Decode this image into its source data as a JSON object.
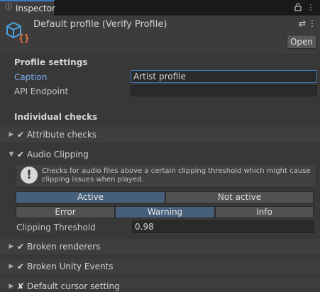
{
  "window": {
    "tab_label": "Inspector",
    "tab_icon": "info-icon",
    "lock_icon": "lock-icon",
    "menu_icon": "more-vertical-icon"
  },
  "header": {
    "title": "Default profile (Verify Profile)",
    "asset_icon": "cube-asset-icon",
    "settings_icon": "sliders-icon",
    "menu_icon": "more-vertical-icon",
    "open_label": "Open"
  },
  "profile_settings": {
    "heading": "Profile settings",
    "caption_label": "Caption",
    "caption_value": "Artist profile",
    "api_label": "API Endpoint",
    "api_value": ""
  },
  "checks": {
    "heading": "Individual checks",
    "attribute": {
      "label": "Attribute checks",
      "enabled": true
    },
    "audio": {
      "label": "Audio Clipping",
      "enabled": true,
      "help_text": "Checks for audio files above a certain clipping threshold which might cause clipping issues when played.",
      "active_label": "Active",
      "not_active_label": "Not active",
      "severity_error": "Error",
      "severity_warning": "Warning",
      "severity_info": "Info",
      "threshold_label": "Clipping Threshold",
      "threshold_value": "0.98"
    },
    "broken_renderers": {
      "label": "Broken renderers",
      "enabled": true
    },
    "broken_events": {
      "label": "Broken Unity Events",
      "enabled": true
    },
    "default_cursor": {
      "label": "Default cursor setting",
      "enabled": false
    }
  },
  "colors": {
    "accent": "#3a79bb",
    "selected_toggle": "#46607c",
    "panel": "#383838",
    "caption_label": "#7cadee"
  }
}
